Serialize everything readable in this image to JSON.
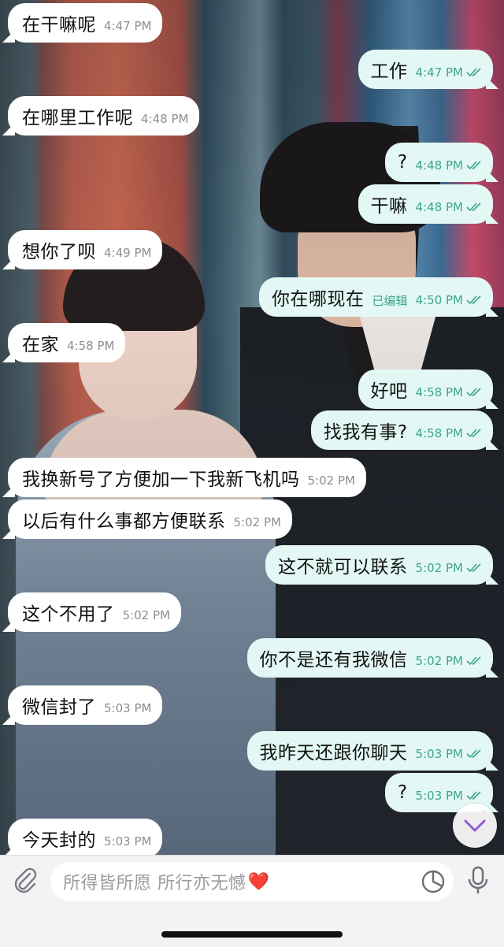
{
  "messages": [
    {
      "dir": "in",
      "text": "在干嘛呢",
      "time": "4:47 PM"
    },
    {
      "dir": "out",
      "text": "工作",
      "time": "4:47 PM"
    },
    {
      "dir": "in",
      "text": "在哪里工作呢",
      "time": "4:48 PM"
    },
    {
      "dir": "out",
      "text": "?",
      "time": "4:48 PM"
    },
    {
      "dir": "out",
      "text": "干嘛",
      "time": "4:48 PM"
    },
    {
      "dir": "in",
      "text": "想你了呗",
      "time": "4:49 PM"
    },
    {
      "dir": "out",
      "text": "你在哪现在",
      "edited": "已编辑",
      "time": "4:50 PM"
    },
    {
      "dir": "in",
      "text": "在家",
      "time": "4:58 PM"
    },
    {
      "dir": "out",
      "text": "好吧",
      "time": "4:58 PM"
    },
    {
      "dir": "out",
      "text": "找我有事?",
      "time": "4:58 PM"
    },
    {
      "dir": "in",
      "text": "我换新号了方便加一下我新飞机吗",
      "time": "5:02 PM"
    },
    {
      "dir": "in",
      "text": "以后有什么事都方便联系",
      "time": "5:02 PM"
    },
    {
      "dir": "out",
      "text": "这不就可以联系",
      "time": "5:02 PM"
    },
    {
      "dir": "in",
      "text": "这个不用了",
      "time": "5:02 PM"
    },
    {
      "dir": "out",
      "text": "你不是还有我微信",
      "time": "5:02 PM"
    },
    {
      "dir": "in",
      "text": "微信封了",
      "time": "5:03 PM"
    },
    {
      "dir": "out",
      "text": "我昨天还跟你聊天",
      "time": "5:03 PM"
    },
    {
      "dir": "out",
      "text": "?",
      "time": "5:03 PM"
    },
    {
      "dir": "in",
      "text": "今天封的",
      "time": "5:03 PM"
    }
  ],
  "input": {
    "placeholder": "所得皆所愿 所行亦无憾",
    "emoji": "❤️"
  },
  "icons": {
    "attach": "paperclip-icon",
    "sticker": "sticker-icon",
    "mic": "microphone-icon",
    "scroll": "chevron-down-icon",
    "read": "double-check-icon"
  },
  "colors": {
    "incoming_bubble": "#ffffff",
    "outgoing_bubble": "#e3f8f4",
    "accent": "#3da58c",
    "scroll_chevron": "#8e5bd1"
  }
}
